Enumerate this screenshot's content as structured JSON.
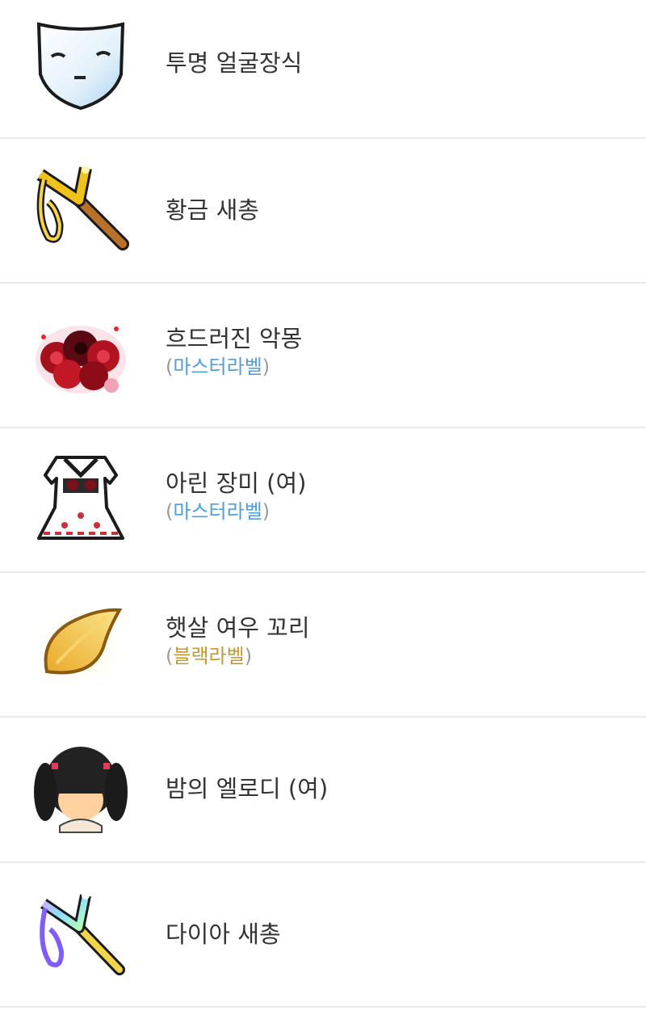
{
  "items": [
    {
      "name": "투명 얼굴장식",
      "label": null,
      "icon": "transparent-face-mask-icon"
    },
    {
      "name": "황금 새총",
      "label": null,
      "icon": "golden-slingshot-icon"
    },
    {
      "name": "흐드러진 악몽",
      "label": {
        "open": "(",
        "text": "마스터라벨",
        "close": ")",
        "kind": "master"
      },
      "icon": "nightmare-roses-icon"
    },
    {
      "name": "아린 장미 (여)",
      "label": {
        "open": "(",
        "text": "마스터라벨",
        "close": ")",
        "kind": "master"
      },
      "icon": "rose-dress-icon"
    },
    {
      "name": "햇살 여우 꼬리",
      "label": {
        "open": "(",
        "text": "블랙라벨",
        "close": ")",
        "kind": "black"
      },
      "icon": "sunlight-fox-tail-icon"
    },
    {
      "name": "밤의 엘로디 (여)",
      "label": null,
      "icon": "night-elody-hair-icon"
    },
    {
      "name": "다이아 새총",
      "label": null,
      "icon": "diamond-slingshot-icon"
    }
  ],
  "colors": {
    "master_label": "#4f9fd8",
    "black_label": "#c49a2c",
    "divider": "#e9e9e9",
    "text": "#333333"
  }
}
